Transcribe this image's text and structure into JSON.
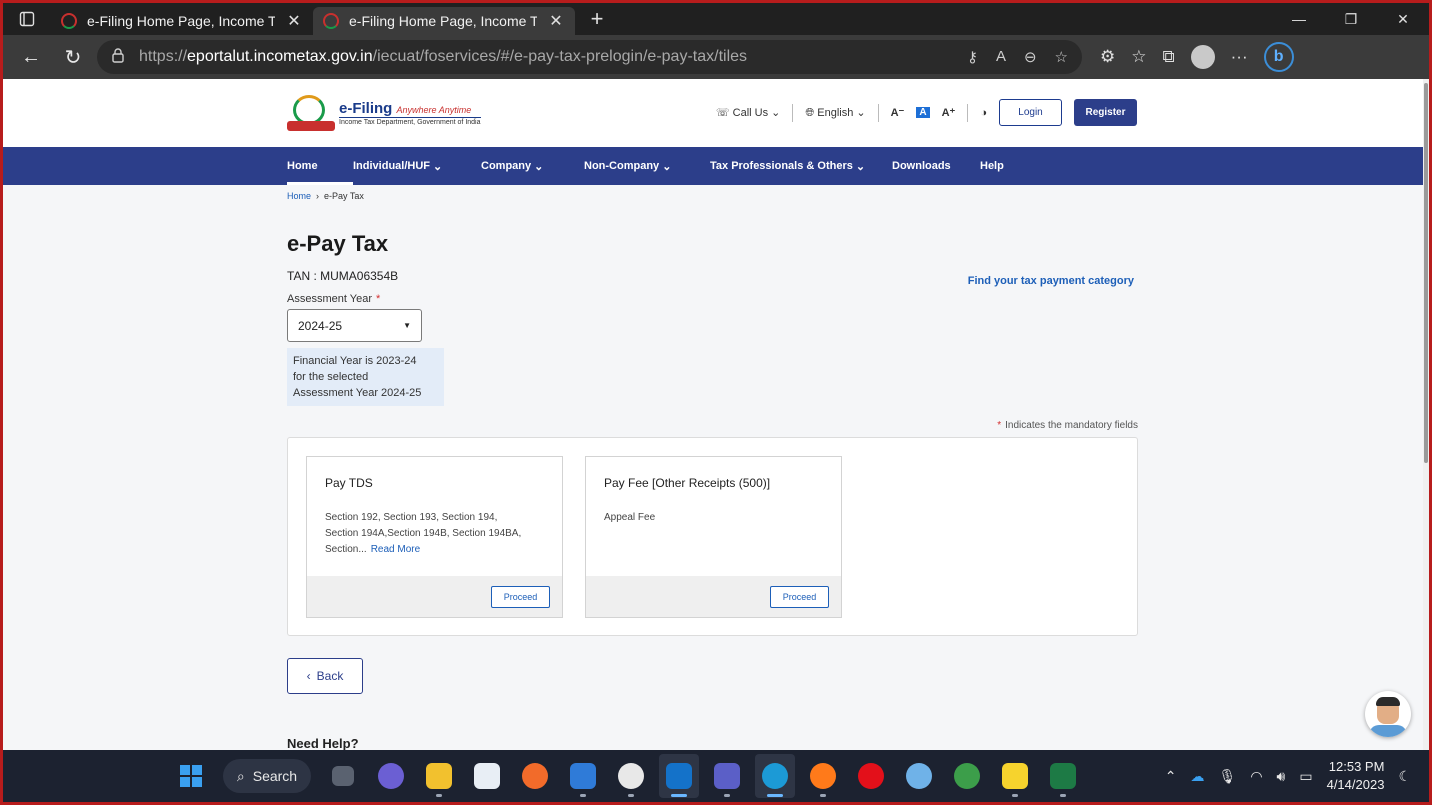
{
  "browser": {
    "tabs": [
      {
        "title": "e-Filing Home Page, Income Tax",
        "active": false
      },
      {
        "title": "e-Filing Home Page, Income Tax",
        "active": true
      }
    ],
    "url_prefix": "https://",
    "url_host": "eportalut.incometax.gov.in",
    "url_path": "/iecuat/foservices/#/e-pay-tax-prelogin/e-pay-tax/tiles"
  },
  "header": {
    "brand": "e-Filing",
    "tagline": "Anywhere Anytime",
    "subtitle": "Income Tax Department, Government of India",
    "call_us": "Call Us",
    "language": "English",
    "font_small": "A⁻",
    "font_normal": "A",
    "font_large": "A⁺",
    "login": "Login",
    "register": "Register"
  },
  "nav": {
    "items": [
      {
        "label": "Home",
        "dropdown": false
      },
      {
        "label": "Individual/HUF",
        "dropdown": true
      },
      {
        "label": "Company",
        "dropdown": true
      },
      {
        "label": "Non-Company",
        "dropdown": true
      },
      {
        "label": "Tax Professionals & Others",
        "dropdown": true
      },
      {
        "label": "Downloads",
        "dropdown": false
      },
      {
        "label": "Help",
        "dropdown": false
      }
    ]
  },
  "breadcrumb": {
    "home": "Home",
    "current": "e-Pay Tax"
  },
  "page": {
    "title": "e-Pay Tax",
    "tan": "TAN : MUMA06354B",
    "find_link": "Find your tax payment category",
    "ay_label": "Assessment Year",
    "ay_value": "2024-25",
    "fy_info_1": "Financial Year is 2023-24",
    "fy_info_2": "for the selected",
    "fy_info_3": "Assessment Year 2024-25",
    "mandatory_note": "Indicates the mandatory fields",
    "required_mark": "*"
  },
  "cards": [
    {
      "title": "Pay TDS",
      "desc_1": "Section 192, Section 193, Section 194,",
      "desc_2": "Section 194A,Section 194B, Section 194BA,",
      "desc_3": "Section...",
      "read_more": "Read More",
      "action": "Proceed"
    },
    {
      "title": "Pay Fee [Other Receipts (500)]",
      "desc_1": "Appeal Fee",
      "action": "Proceed"
    }
  ],
  "back_label": "Back",
  "need_help": "Need Help?",
  "taskbar": {
    "search_label": "Search",
    "time": "12:53 PM",
    "date": "4/14/2023"
  }
}
